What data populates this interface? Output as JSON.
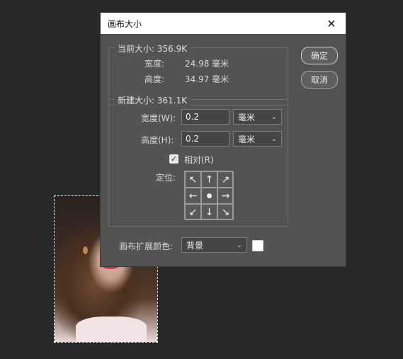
{
  "dialog": {
    "title": "画布大小",
    "ok_label": "确定",
    "cancel_label": "取消"
  },
  "current_size": {
    "legend": "当前大小: 356.9K",
    "width_label": "宽度:",
    "width_value": "24.98 毫米",
    "height_label": "高度:",
    "height_value": "34.97 毫米"
  },
  "new_size": {
    "legend": "新建大小: 361.1K",
    "width_label": "宽度(W):",
    "width_value": "0.2",
    "width_unit": "毫米",
    "height_label": "高度(H):",
    "height_value": "0.2",
    "height_unit": "毫米",
    "relative_label": "相对(R)",
    "relative_checked": true,
    "anchor_label": "定位:",
    "anchor_arrows": [
      "↖",
      "↑",
      "↗",
      "←",
      "●",
      "→",
      "↙",
      "↓",
      "↘"
    ]
  },
  "extension": {
    "label": "画布扩展颜色:",
    "value": "背景",
    "swatch_color": "#ffffff"
  },
  "colors": {
    "background": "#282828",
    "dialog_bg": "#535353"
  }
}
